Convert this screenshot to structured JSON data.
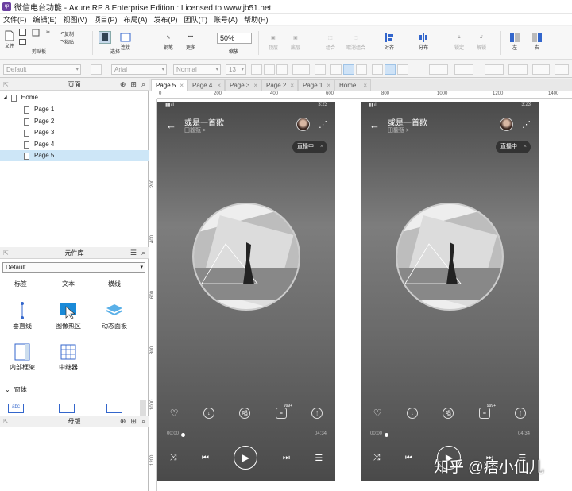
{
  "window": {
    "title": "微信电台功能 - Axure RP 8 Enterprise Edition : Licensed to www.jb51.net",
    "logo": "rp"
  },
  "menu": [
    "文件(F)",
    "编辑(E)",
    "视图(V)",
    "项目(P)",
    "布局(A)",
    "发布(P)",
    "团队(T)",
    "账号(A)",
    "帮助(H)"
  ],
  "toolbar": {
    "file": "文件",
    "clipboard": "剪贴板",
    "cut": "剪切",
    "copy": "复制",
    "paste": "粘贴",
    "select": "选择",
    "connect": "连接",
    "pen": "钢笔",
    "more": "更多",
    "zoom_value": "50%",
    "zoom_label": "缩放",
    "top": "顶层",
    "bottom": "底层",
    "group": "组合",
    "ungroup": "取消组合",
    "align": "对齐",
    "distribute": "分布",
    "lock": "锁定",
    "unlock": "解锁",
    "left": "左",
    "right": "右"
  },
  "format": {
    "style": "Default",
    "font": "Arial",
    "weight": "Normal",
    "size": "13"
  },
  "pages_panel": {
    "title": "页面",
    "root": "Home",
    "pages": [
      "Page 1",
      "Page 2",
      "Page 3",
      "Page 4",
      "Page 5"
    ]
  },
  "library_panel": {
    "title": "元件库",
    "selected": "Default",
    "items_row1": [
      "标签",
      "文本",
      "横线"
    ],
    "items_row2": [
      "垂直线",
      "图像热区",
      "动态面板"
    ],
    "items_row3": [
      "内部框架",
      "中继器"
    ],
    "section": "窗体"
  },
  "master_panel": {
    "title": "母版"
  },
  "tabs": [
    "Page 5",
    "Page 4",
    "Page 3",
    "Page 2",
    "Page 1",
    "Home"
  ],
  "ruler_top": [
    "0",
    "200",
    "400",
    "600",
    "800",
    "1000",
    "1200",
    "1400"
  ],
  "ruler_left": [
    "200",
    "400",
    "600",
    "800",
    "1000",
    "1200"
  ],
  "phone": {
    "status_time": "3:23",
    "song": "或是一首歌",
    "artist": "田馥甄 >",
    "live": "直播中",
    "time_start": "00:00",
    "time_end": "04:34",
    "comment_badge": "999+",
    "lyric_icon": "唱"
  },
  "watermark": "知乎 @痞小仙儿"
}
